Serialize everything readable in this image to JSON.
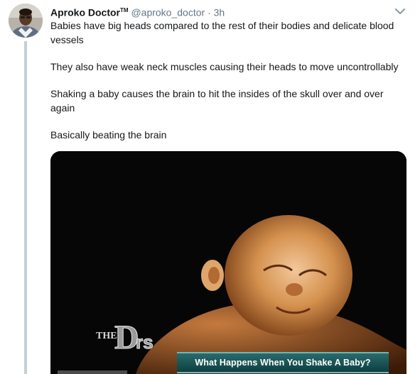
{
  "tweet": {
    "display_name": "Aproko Doctor",
    "tm": "TM",
    "handle": "@aproko_doctor",
    "separator": "·",
    "time": "3h",
    "paragraphs": [
      "Babies have big heads compared to the rest of their bodies and delicate blood vessels",
      "They also have weak neck muscles causing their heads to move uncontrollably",
      "Shaking a baby causes the brain to hit the insides of the skull over and over again",
      "Basically beating the brain"
    ]
  },
  "media": {
    "caption": "What Happens When You Shake A Baby?",
    "logo_text": "THE DRS"
  },
  "icons": {
    "caret": "chevron-down-icon",
    "avatar": "avatar"
  },
  "colors": {
    "text": "#14171a",
    "muted": "#657786",
    "thread_line": "#c4cfd6",
    "caption_bar": "#1d5556"
  }
}
